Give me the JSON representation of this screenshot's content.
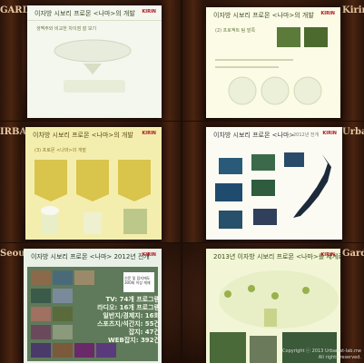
{
  "panels": [
    {
      "title": "이자방 시보리 프로몬 <나마>의 개발",
      "subtitle": "생맥주와 비교한 차이점 잘 보기",
      "logo": "KIRIN"
    },
    {
      "title": "이자방 시보리 프로몬 <나마>의 개발",
      "subtitle": "(2) 프로젝트 팀 발족",
      "logo": "KIRIN"
    },
    {
      "title": "이차방 시보리 프로몬 <나마>의 개발",
      "subtitle": "(3) 프로몬 <나마>의 개발",
      "logo": "KIRIN"
    },
    {
      "title": "이차방 시보리 프로몬 <나마>",
      "subtitle": "2012년 전개",
      "logo": "KIRIN"
    },
    {
      "title": "이자방 시보리 프로몬 <나마> 2012년 전개",
      "logo": "KIRIN",
      "callout": "신문 및 잡지에도 300회 이상 게재",
      "stats": [
        "TV: 74개 프로그램",
        "라디오: 16개 프로그램",
        "일반지/경제지: 16회",
        "스포츠지/석간지: 55건",
        "잡지: 47건",
        "WEB잡지: 392건"
      ]
    },
    {
      "title": "2013년 이자방 시보리 프로몬 <나마>를 세계로",
      "logo": "KIRIN"
    }
  ],
  "banner": {
    "left_words": [
      "IRBAN",
      "GARDEN",
      "Seoul"
    ],
    "right_words": [
      "Kirin",
      "Urban",
      "Garden"
    ]
  },
  "watermark": {
    "line1": "Copyright ⓒ 2013 Urbanist-lab.me",
    "line2": "All rights reserved."
  }
}
